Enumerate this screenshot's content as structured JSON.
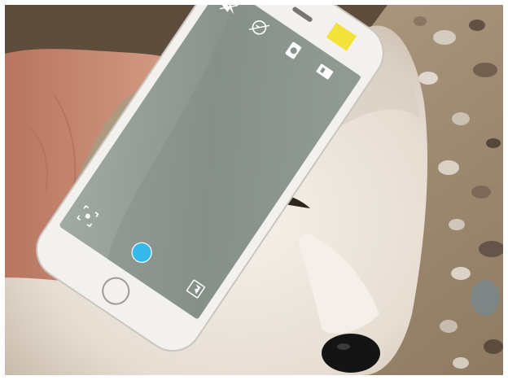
{
  "scene": {
    "kind": "photo",
    "subjects": [
      "hand",
      "smartphone",
      "dog",
      "terrazzo-floor"
    ]
  },
  "phone": {
    "camera_app": {
      "icons": [
        "flash-off-icon",
        "timer-off-icon",
        "camera-switch-icon",
        "photo-mode-icon",
        "focus-icon",
        "gallery-icon"
      ],
      "shutter_color": "#35b9ea"
    },
    "sticker_color": "#f2e23a"
  },
  "colors": {
    "dog_fur": "#ece6dc",
    "dog_dark": "#3a2f26",
    "floor_base": "#a08a70",
    "skin": "#c98d75",
    "phone_body": "#f3f1ee"
  }
}
